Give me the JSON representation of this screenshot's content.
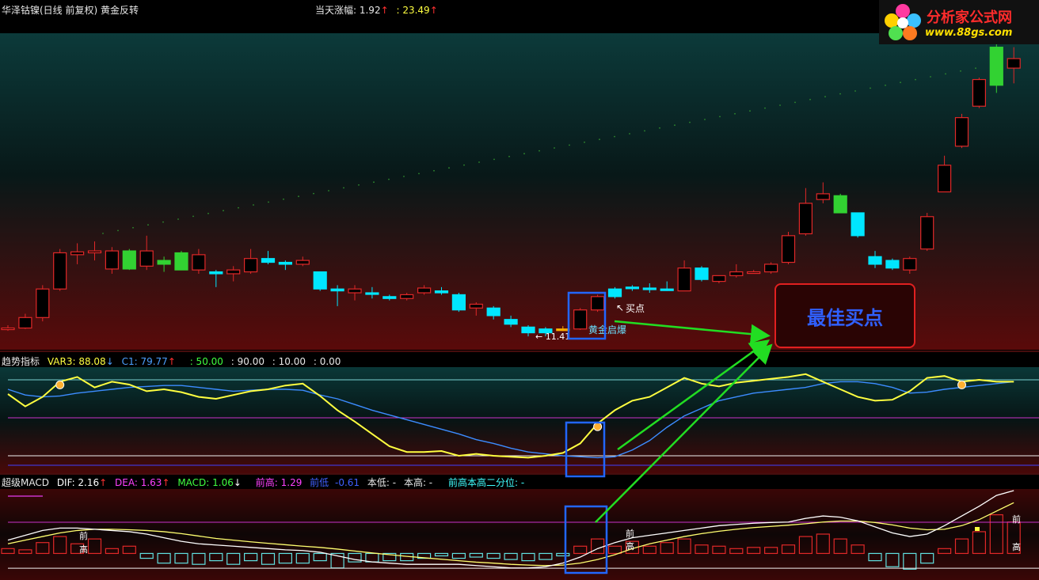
{
  "main_panel": {
    "title": "华泽钴镍(日线 前复权) 黄金反转",
    "change_label": "当天涨幅: 1.92",
    "change_value": ": 23.49",
    "marks": {
      "buy_point": "买点",
      "golden_start": "黄金启爆",
      "low_price": "← 11.41"
    }
  },
  "trend_panel": {
    "title": "趋势指标",
    "var3": "VAR3: 88.08",
    "c1": "C1: 79.77",
    "levels": [
      ": 50.00",
      ": 90.00",
      ": 10.00",
      ": 0.00"
    ]
  },
  "macd_panel": {
    "title": "超级MACD",
    "dif": "DIF: 2.16",
    "dea": "DEA: 1.63",
    "macd": "MACD: 1.06",
    "prev_high": "前高: 1.29",
    "prev_low_label": "前低",
    "prev_low_value": "-0.61",
    "this_low": "本低: -",
    "this_high": "本高: -",
    "quantile": "前高本高二分位: -",
    "marker_a": "前",
    "marker_b": "高"
  },
  "callout": {
    "text": "最佳买点"
  },
  "logo": {
    "name": "分析家公式网",
    "url": "www.88gs.com"
  },
  "colors": {
    "up": "#e02828",
    "down": "#00e6ff",
    "highlight": "#32d232",
    "yellow_line": "#ffff40",
    "blue_line": "#3c8cff",
    "magenta": "#c832c8",
    "arrow": "#22dd22",
    "box": "#2266ff"
  },
  "chart_data": [
    {
      "type": "candlestick",
      "title": "华泽钴镍(日线 前复权) 黄金反转",
      "ohlc": [
        [
          11.8,
          12.0,
          11.7,
          11.85
        ],
        [
          11.85,
          12.6,
          11.8,
          12.4
        ],
        [
          12.4,
          14.1,
          12.2,
          13.9
        ],
        [
          13.9,
          16.0,
          13.8,
          15.8
        ],
        [
          15.7,
          16.3,
          15.2,
          15.85
        ],
        [
          15.8,
          16.4,
          15.4,
          15.9
        ],
        [
          15.9,
          16.1,
          14.7,
          14.95
        ],
        [
          14.95,
          16.0,
          14.9,
          15.9
        ],
        [
          15.9,
          16.7,
          14.9,
          15.1
        ],
        [
          15.4,
          15.6,
          14.8,
          15.2
        ],
        [
          14.9,
          15.9,
          14.9,
          15.8
        ],
        [
          15.7,
          16.0,
          14.7,
          14.9
        ],
        [
          14.8,
          14.9,
          14.0,
          14.7
        ],
        [
          14.7,
          15.1,
          14.3,
          14.9
        ],
        [
          14.8,
          16.0,
          14.7,
          15.5
        ],
        [
          15.5,
          15.9,
          15.2,
          15.3
        ],
        [
          15.3,
          15.4,
          14.9,
          15.2
        ],
        [
          15.2,
          15.6,
          15.1,
          15.4
        ],
        [
          14.8,
          14.8,
          13.8,
          13.9
        ],
        [
          13.9,
          14.1,
          13.0,
          13.8
        ],
        [
          13.7,
          14.1,
          13.3,
          13.9
        ],
        [
          13.7,
          14.0,
          13.4,
          13.65
        ],
        [
          13.5,
          13.6,
          13.3,
          13.4
        ],
        [
          13.4,
          13.7,
          13.3,
          13.6
        ],
        [
          13.7,
          14.1,
          13.6,
          13.95
        ],
        [
          13.8,
          14.0,
          13.6,
          13.7
        ],
        [
          13.6,
          13.7,
          12.7,
          12.8
        ],
        [
          12.9,
          13.2,
          12.5,
          13.1
        ],
        [
          12.9,
          13.0,
          12.3,
          12.5
        ],
        [
          12.3,
          12.5,
          11.9,
          12.05
        ],
        [
          11.9,
          12.0,
          11.41,
          11.6
        ],
        [
          11.6,
          11.9,
          11.41,
          11.8
        ],
        [
          11.8,
          11.95,
          11.7,
          11.8
        ],
        [
          11.8,
          12.9,
          11.75,
          12.8
        ],
        [
          12.8,
          13.6,
          12.7,
          13.5
        ],
        [
          13.5,
          14.0,
          13.4,
          13.9
        ],
        [
          14.0,
          14.1,
          13.8,
          13.95
        ],
        [
          13.95,
          14.2,
          13.7,
          13.95
        ],
        [
          13.9,
          14.3,
          13.8,
          13.9
        ],
        [
          13.8,
          15.4,
          13.8,
          15.0
        ],
        [
          15.0,
          15.1,
          14.3,
          14.4
        ],
        [
          14.3,
          14.6,
          14.2,
          14.6
        ],
        [
          14.6,
          15.2,
          14.5,
          14.8
        ],
        [
          14.8,
          14.9,
          14.7,
          14.8
        ],
        [
          14.8,
          15.3,
          14.7,
          15.2
        ],
        [
          15.3,
          16.9,
          15.2,
          16.7
        ],
        [
          16.8,
          19.2,
          16.7,
          18.4
        ],
        [
          18.6,
          19.5,
          18.4,
          18.9
        ],
        [
          18.8,
          18.9,
          17.9,
          17.9
        ],
        [
          17.9,
          17.9,
          16.6,
          16.7
        ],
        [
          15.6,
          15.9,
          15.0,
          15.2
        ],
        [
          15.4,
          15.5,
          14.9,
          15.0
        ],
        [
          14.9,
          15.6,
          14.7,
          15.5
        ],
        [
          16.0,
          17.9,
          15.9,
          17.7
        ],
        [
          19.0,
          20.9,
          19.0,
          20.4
        ],
        [
          21.4,
          23.1,
          21.3,
          22.9
        ],
        [
          23.5,
          25.0,
          23.4,
          24.9
        ],
        [
          26.6,
          26.9,
          24.2,
          24.6
        ],
        [
          25.5,
          26.6,
          24.7,
          26.0
        ]
      ],
      "style": [
        "up",
        "up",
        "up",
        "up",
        "up",
        "up",
        "up",
        "highlight",
        "up",
        "highlight",
        "highlight",
        "up",
        "down",
        "up",
        "up",
        "down",
        "down",
        "up",
        "down",
        "down",
        "up",
        "down",
        "down",
        "up",
        "up",
        "down",
        "down",
        "up",
        "down",
        "down",
        "down",
        "down",
        "gold",
        "up",
        "up",
        "down",
        "down",
        "down",
        "down",
        "up",
        "down",
        "up",
        "up",
        "up",
        "up",
        "up",
        "up",
        "up",
        "highlight",
        "down",
        "down",
        "down",
        "up",
        "up",
        "up",
        "up",
        "up",
        "highlight",
        "up"
      ],
      "ylim": [
        11.0,
        27.0
      ]
    },
    {
      "type": "line",
      "title": "趋势指标",
      "ylim": [
        0,
        100
      ],
      "levels": [
        90,
        50,
        10,
        0
      ],
      "series": [
        {
          "name": "VAR3",
          "values": [
            75,
            62,
            72,
            88,
            93,
            82,
            88,
            85,
            78,
            80,
            77,
            72,
            70,
            74,
            78,
            80,
            84,
            86,
            73,
            58,
            46,
            33,
            20,
            14,
            14,
            15,
            10,
            12,
            10,
            9,
            8,
            10,
            13,
            23,
            44,
            58,
            68,
            72,
            82,
            92,
            86,
            83,
            87,
            89,
            91,
            93,
            96,
            88,
            80,
            72,
            68,
            69,
            78,
            92,
            94,
            88,
            90,
            88,
            88
          ]
        },
        {
          "name": "C1",
          "values": [
            80,
            74,
            72,
            73,
            76,
            78,
            80,
            82,
            83,
            84,
            84,
            82,
            80,
            78,
            79,
            80,
            80,
            79,
            74,
            70,
            64,
            58,
            53,
            48,
            43,
            38,
            33,
            27,
            23,
            18,
            14,
            12,
            10,
            9,
            8,
            9,
            16,
            26,
            40,
            52,
            60,
            68,
            72,
            76,
            78,
            80,
            82,
            86,
            88,
            88,
            86,
            82,
            76,
            77,
            80,
            82,
            84,
            86,
            88
          ]
        }
      ]
    },
    {
      "type": "bar",
      "title": "超级MACD",
      "ylim": [
        -1.0,
        2.6
      ],
      "values": [
        0.2,
        0.15,
        0.45,
        0.7,
        0.4,
        0.6,
        0.2,
        0.3,
        -0.2,
        -0.4,
        -0.4,
        -0.45,
        -0.3,
        -0.45,
        -0.3,
        -0.45,
        -0.4,
        -0.4,
        -0.3,
        -0.6,
        -0.35,
        -0.35,
        -0.3,
        -0.3,
        -0.2,
        -0.1,
        -0.2,
        -0.15,
        -0.2,
        -0.25,
        -0.3,
        -0.25,
        -0.1,
        0.3,
        0.6,
        0.3,
        0.5,
        0.3,
        0.45,
        0.6,
        0.35,
        0.3,
        0.2,
        0.25,
        0.25,
        0.35,
        0.7,
        0.8,
        0.6,
        0.35,
        -0.3,
        -0.55,
        -0.65,
        -0.4,
        0.2,
        0.6,
        0.9,
        1.6,
        1.3
      ],
      "series": [
        {
          "name": "DIF",
          "values": [
            0.55,
            0.75,
            0.95,
            1.05,
            1.05,
            1.0,
            0.95,
            0.9,
            0.8,
            0.65,
            0.5,
            0.4,
            0.35,
            0.3,
            0.25,
            0.2,
            0.15,
            0.12,
            0.05,
            -0.1,
            -0.25,
            -0.35,
            -0.4,
            -0.45,
            -0.45,
            -0.45,
            -0.45,
            -0.5,
            -0.55,
            -0.6,
            -0.6,
            -0.55,
            -0.4,
            -0.15,
            0.2,
            0.45,
            0.65,
            0.75,
            0.85,
            0.95,
            1.05,
            1.15,
            1.2,
            1.25,
            1.28,
            1.3,
            1.45,
            1.55,
            1.5,
            1.35,
            1.1,
            0.85,
            0.7,
            0.8,
            1.15,
            1.55,
            1.95,
            2.4,
            2.6
          ]
        },
        {
          "name": "DEA",
          "values": [
            0.4,
            0.55,
            0.7,
            0.85,
            0.95,
            1.0,
            1.0,
            0.98,
            0.95,
            0.9,
            0.82,
            0.72,
            0.62,
            0.55,
            0.48,
            0.42,
            0.36,
            0.3,
            0.25,
            0.18,
            0.1,
            0.02,
            -0.05,
            -0.12,
            -0.18,
            -0.24,
            -0.3,
            -0.36,
            -0.4,
            -0.45,
            -0.48,
            -0.5,
            -0.48,
            -0.4,
            -0.25,
            -0.05,
            0.2,
            0.4,
            0.55,
            0.7,
            0.82,
            0.92,
            1.0,
            1.07,
            1.12,
            1.17,
            1.23,
            1.3,
            1.34,
            1.34,
            1.28,
            1.18,
            1.05,
            0.98,
            1.0,
            1.15,
            1.4,
            1.75,
            2.1
          ]
        }
      ]
    }
  ]
}
